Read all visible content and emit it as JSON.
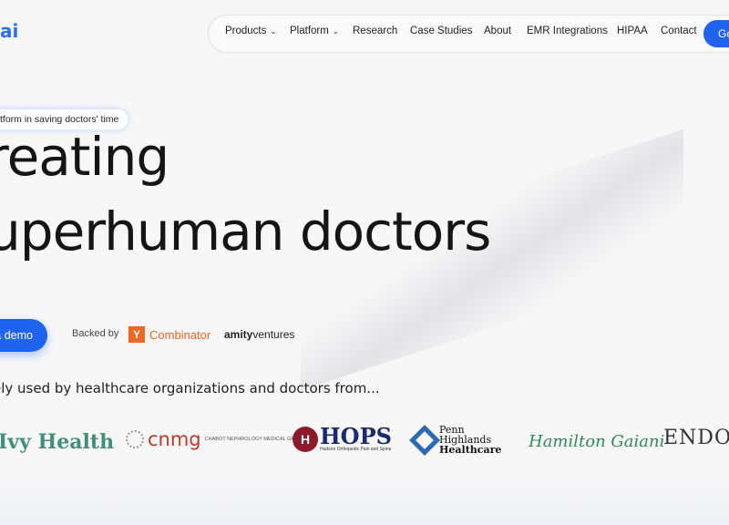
{
  "brand": {
    "logo_fragment": "ai"
  },
  "nav": {
    "items": [
      {
        "label": "Products",
        "dropdown": true
      },
      {
        "label": "Platform",
        "dropdown": true
      },
      {
        "label": "Research",
        "dropdown": false
      },
      {
        "label": "Case Studies",
        "dropdown": false
      },
      {
        "label": "About",
        "dropdown": false
      },
      {
        "label": "EMR Integrations",
        "dropdown": false
      },
      {
        "label": "HIPAA",
        "dropdown": false
      },
      {
        "label": "Contact",
        "dropdown": false
      }
    ],
    "cta_label": "Ge"
  },
  "hero": {
    "pill_text": "tform in saving doctors' time",
    "title_line1": "reating",
    "title_line2": "uperhuman doctors",
    "demo_button": "a demo",
    "backed_by": "Backed by",
    "investors": {
      "yc_mark": "Y",
      "yc_name": "Combinator",
      "amity_bold": "amity",
      "amity_rest": "ventures"
    }
  },
  "trusted": {
    "text": "ely used by healthcare organizations and doctors from...",
    "logos": {
      "ivy": "Ivy Health",
      "cnmg": "cnmg",
      "cnmg_sub": "CHABOT NEPHROLOGY MEDICAL GROUP",
      "hops": "HOPS",
      "hops_sub": "Hudson Orthopedic Pain and Spine",
      "penn_line1": "Penn",
      "penn_line2": "Highlands",
      "penn_line3": "Healthcare",
      "hamilton": "Hamilton Gaiani",
      "endo": "ENDO"
    }
  },
  "colors": {
    "accent": "#1f63f0",
    "yc": "#f26522"
  }
}
